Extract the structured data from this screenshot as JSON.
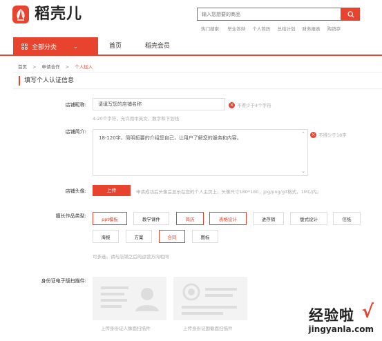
{
  "header": {
    "logo_text": "稻壳儿",
    "search_placeholder": "输入您想要的商品",
    "hot_label": "热门搜索:",
    "hot_items": [
      "毕业答辩",
      "个人简历",
      "总结计划",
      "财务报表",
      "购销存"
    ]
  },
  "nav": {
    "all_categories": "全部分类",
    "links": [
      "首页",
      "稻壳会员"
    ]
  },
  "breadcrumb": [
    "首页",
    "申请合作",
    "个人加入"
  ],
  "breadcrumb_sep": ">",
  "section_title": "填写个人认证信息",
  "form": {
    "shop_name": {
      "label": "店铺昵称:",
      "placeholder": "请填写您的店铺名称",
      "hint": "4-20个字符，允许用中英文、数字和下划线",
      "error": "不得少于4个字符"
    },
    "shop_intro": {
      "label": "店铺简介:",
      "value": "18-120字，简明扼要的介绍您自己，让用户了解您的服务和内容。",
      "error": "不得少于18字"
    },
    "avatar": {
      "label": "店铺头像:",
      "button": "上传",
      "tip": "申请成功后头像会显示在您的个人主页上，头像尺寸180*180，jpg/png/gif格式，1M以内。"
    },
    "work_types": {
      "label": "擅长作品类型:",
      "tags": [
        {
          "label": "ppt模板",
          "selected": true
        },
        {
          "label": "教学课件",
          "selected": false
        },
        {
          "label": "简历",
          "selected": true
        },
        {
          "label": "表格设计",
          "selected": true
        },
        {
          "label": "进存销",
          "selected": false
        },
        {
          "label": "版式设计",
          "selected": false
        },
        {
          "label": "信纸",
          "selected": false
        },
        {
          "label": "海报",
          "selected": false
        },
        {
          "label": "方案",
          "selected": false
        },
        {
          "label": "合同",
          "selected": true
        },
        {
          "label": "图标",
          "selected": false
        }
      ],
      "tip": "可多选，请与店铺之后的运营方向相同"
    },
    "id_card": {
      "label": "身份证电子版扫描件:",
      "front_caption": "上传身份证人像面扫描件",
      "back_caption": "上传身份证国徽面扫描件"
    }
  },
  "watermark": {
    "text": "经验啦",
    "check": "√",
    "url": "jingyanla.com"
  },
  "colors": {
    "accent": "#e8432e"
  }
}
